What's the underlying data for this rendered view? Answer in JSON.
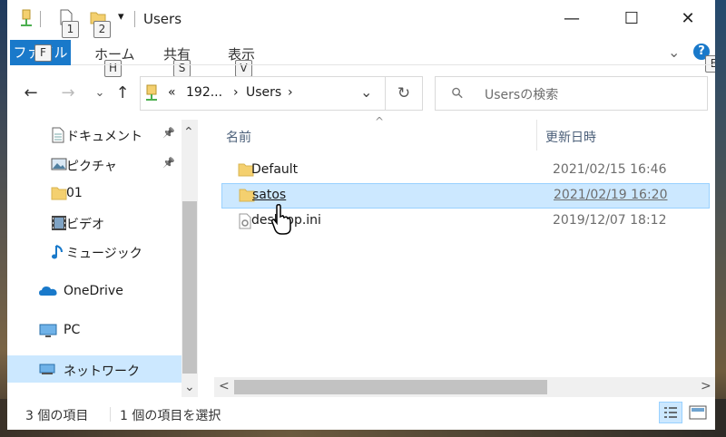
{
  "window": {
    "title": "Users",
    "minimize_glyph": "—",
    "maximize_glyph": "☐",
    "close_glyph": "✕"
  },
  "quick_access": {
    "dropdown_glyph": "▾",
    "keytips": [
      "1",
      "2"
    ]
  },
  "ribbon": {
    "file_tab": {
      "label": "ファイル",
      "keytip": "F"
    },
    "tabs": [
      {
        "label": "ホーム",
        "keytip": "H"
      },
      {
        "label": "共有",
        "keytip": "S"
      },
      {
        "label": "表示",
        "keytip": "V"
      }
    ],
    "help_keytip": "E",
    "expand_glyph": "⌄",
    "help_glyph": "?"
  },
  "address_bar": {
    "back_glyph": "←",
    "forward_glyph": "→",
    "recent_glyph": "⌄",
    "up_glyph": "↑",
    "overflow": "«",
    "path": [
      "192...",
      "Users"
    ],
    "separator": "›",
    "dropdown_glyph": "⌄",
    "refresh_glyph": "↻"
  },
  "search": {
    "placeholder": "Usersの検索",
    "icon_glyph": "⚲"
  },
  "nav_pane": {
    "items": [
      {
        "label": "ドキュメント",
        "icon": "documents-icon",
        "pinned": true
      },
      {
        "label": "ピクチャ",
        "icon": "pictures-icon",
        "pinned": true
      },
      {
        "label": "01",
        "icon": "folder-icon",
        "pinned": false
      },
      {
        "label": "ビデオ",
        "icon": "videos-icon",
        "pinned": false
      },
      {
        "label": "ミュージック",
        "icon": "music-icon",
        "pinned": false
      },
      {
        "label": "OneDrive",
        "icon": "onedrive-icon",
        "pinned": false
      },
      {
        "label": "PC",
        "icon": "pc-icon",
        "pinned": false
      },
      {
        "label": "ネットワーク",
        "icon": "network-icon",
        "pinned": false
      }
    ],
    "pin_glyph": "📌",
    "scroll_up_glyph": "⌃",
    "scroll_down_glyph": "⌄"
  },
  "file_list": {
    "sort_glyph": "^",
    "columns": {
      "name": "名前",
      "modified": "更新日時"
    },
    "rows": [
      {
        "name": "Default",
        "modified": "2021/02/15 16:46",
        "type": "folder"
      },
      {
        "name": "satos",
        "modified": "2021/02/19 16:20",
        "type": "folder"
      },
      {
        "name": "desktop.ini",
        "modified": "2019/12/07 18:12",
        "type": "settings-file"
      }
    ],
    "hscroll_left": "<",
    "hscroll_right": ">"
  },
  "status_bar": {
    "item_count": "3 個の項目",
    "selected_count": "1 個の項目を選択"
  },
  "colors": {
    "accent": "#1979ca",
    "selection": "#cce8ff",
    "selection_border": "#99d1ff",
    "folder": "#f4d06f"
  }
}
